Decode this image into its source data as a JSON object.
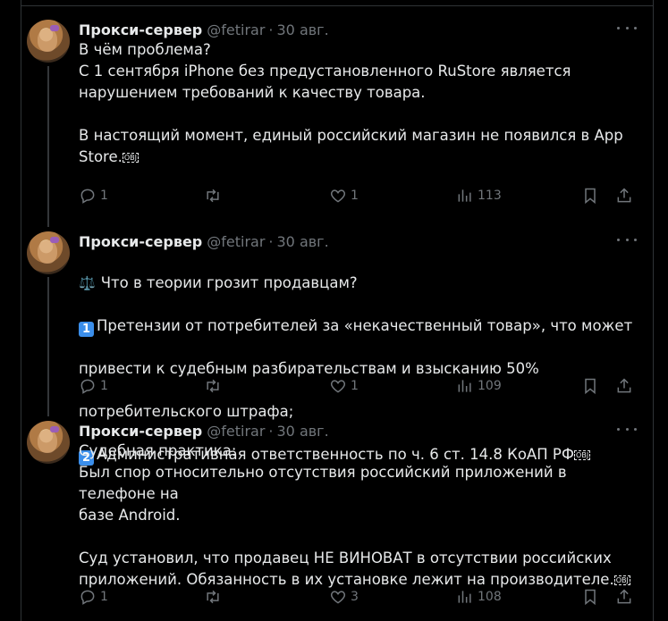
{
  "tweets": [
    {
      "name": "Прокси-сервер",
      "handle": "@fetirar",
      "separator": "·",
      "date": "30 авг.",
      "lines": [
        "В чём проблема?",
        "С 1 сентября iPhone без предустановленного RuStore является",
        "нарушением требований к качеству товара.",
        "",
        "В настоящий момент, единый российский магазин не появился в App",
        "Store."
      ],
      "replies": "1",
      "retweets": "",
      "likes": "1",
      "views": "113"
    },
    {
      "name": "Прокси-сервер",
      "handle": "@fetirar",
      "separator": "·",
      "date": "30 авг.",
      "emoji_scales": "⚖️",
      "line1": "Что в теории грозит продавцам?",
      "badge1": "1",
      "line2": "Претензии от потребителей за «некачественный товар», что может",
      "line3": "привести к судебным разбирательствам и взысканию 50%",
      "line4": "потребительского штрафа;",
      "badge2": "2",
      "line5": "Административная ответственность по ч. 6 ст. 14.8 КоАП РФ",
      "replies": "1",
      "retweets": "",
      "likes": "1",
      "views": "109"
    },
    {
      "name": "Прокси-сервер",
      "handle": "@fetirar",
      "separator": "·",
      "date": "30 авг.",
      "lines": [
        "Судебная практика:",
        "Был спор относительно отсутствия российский приложений в телефоне на",
        "базе Android.",
        "",
        "Суд установил, что продавец НЕ ВИНОВАТ в отсутствии российских",
        "приложений. Обязанность в их установке лежит на производителе."
      ],
      "replies": "1",
      "retweets": "",
      "likes": "3",
      "views": "108"
    }
  ],
  "obj_glyph": "OBJ",
  "icons": {
    "reply": "reply-icon",
    "retweet": "retweet-icon",
    "like": "heart-icon",
    "views": "views-icon",
    "bookmark": "bookmark-icon",
    "share": "share-icon",
    "more": "more-icon"
  },
  "colors": {
    "background": "#000000",
    "text": "#e7e9ea",
    "muted": "#71767b",
    "border": "#2f3336",
    "keycap": "#3b8eea"
  }
}
